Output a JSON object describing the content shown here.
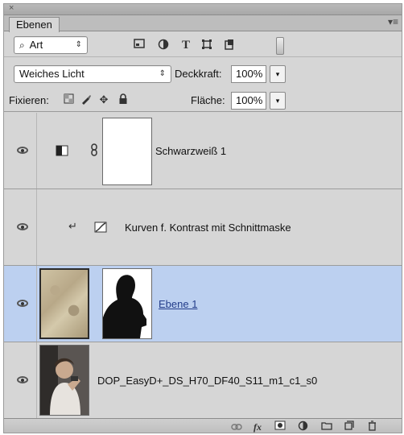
{
  "panel": {
    "close_glyph": "×",
    "tab_label": "Ebenen",
    "menu_glyph": "▾≡"
  },
  "filter": {
    "search_glyph": "⌕",
    "kind_value": "Art",
    "arrows": "⇕"
  },
  "blend": {
    "mode_value": "Weiches Licht",
    "opacity_label": "Deckkraft:",
    "opacity_value": "100%",
    "stepper": "▾"
  },
  "lock": {
    "label": "Fixieren:",
    "fill_label": "Fläche:",
    "fill_value": "100%",
    "stepper": "▾"
  },
  "filter_icons": [
    "image-filter-icon",
    "adjustment-filter-icon",
    "type-filter-icon",
    "shape-filter-icon",
    "smart-object-filter-icon"
  ],
  "layers": [
    {
      "name": "Schwarzweiß 1",
      "type": "adjustment",
      "selected": false
    },
    {
      "name": "Kurven f. Kontrast mit Schnittmaske",
      "type": "adjustment-clipped",
      "selected": false
    },
    {
      "name": "Ebene 1",
      "type": "masked-layer",
      "selected": true
    },
    {
      "name": "DOP_EasyD+_DS_H70_DF40_S11_m1_c1_s0",
      "type": "photo",
      "selected": false
    }
  ],
  "footer_icons": [
    "link-icon",
    "fx-icon",
    "mask-icon",
    "adjustment-icon",
    "group-icon",
    "new-layer-icon",
    "trash-icon"
  ],
  "colors": {
    "selected_row": "#bcd0f0",
    "panel_bg": "#d6d6d6",
    "link_text": "#233d8a"
  }
}
